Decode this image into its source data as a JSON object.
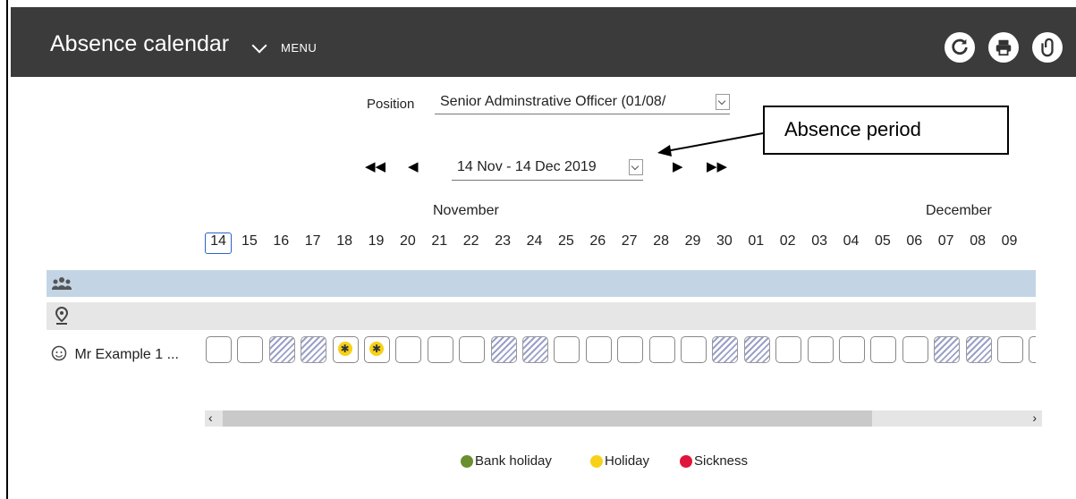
{
  "header": {
    "title": "Absence calendar",
    "menu_label": "MENU"
  },
  "toolbar": {
    "refresh_icon": "refresh-icon",
    "print_icon": "print-icon",
    "attach_icon": "paperclip-icon"
  },
  "position": {
    "label": "Position",
    "value": "Senior Adminstrative Officer (01/08/"
  },
  "annotation": {
    "text": "Absence period"
  },
  "period": {
    "value": "14 Nov - 14 Dec 2019"
  },
  "months": [
    "November",
    "December"
  ],
  "days": [
    "14",
    "15",
    "16",
    "17",
    "18",
    "19",
    "20",
    "21",
    "22",
    "23",
    "24",
    "25",
    "26",
    "27",
    "28",
    "29",
    "30",
    "01",
    "02",
    "03",
    "04",
    "05",
    "06",
    "07",
    "08",
    "09"
  ],
  "employee": {
    "name": "Mr Example 1 ..."
  },
  "cells": [
    "normal",
    "normal",
    "weekend",
    "weekend",
    "holiday",
    "holiday",
    "normal",
    "normal",
    "normal",
    "weekend",
    "weekend",
    "normal",
    "normal",
    "normal",
    "normal",
    "normal",
    "weekend",
    "weekend",
    "normal",
    "normal",
    "normal",
    "normal",
    "normal",
    "weekend",
    "weekend",
    "normal",
    "normal"
  ],
  "legend": [
    {
      "label": "Bank holiday",
      "color": "#6a8f2e"
    },
    {
      "label": "Holiday",
      "color": "#f7d117"
    },
    {
      "label": "Sickness",
      "color": "#e0153b"
    }
  ]
}
